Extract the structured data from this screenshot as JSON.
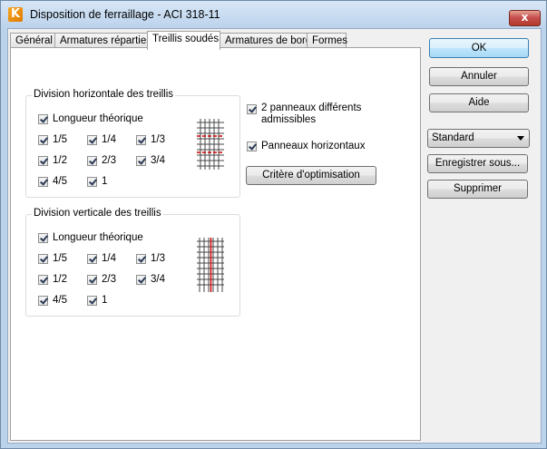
{
  "window": {
    "title": "Disposition de ferraillage - ACI 318-11",
    "app_icon_letter": "K",
    "close_glyph": "x"
  },
  "tabs": [
    {
      "label": "Général",
      "active": false
    },
    {
      "label": "Armatures réparties",
      "active": false
    },
    {
      "label": "Treillis soudés",
      "active": true
    },
    {
      "label": "Armatures de bord",
      "active": false
    },
    {
      "label": "Formes",
      "active": false
    }
  ],
  "horizontal_group": {
    "label": "Division horizontale des treillis",
    "theoretical": {
      "label": "Longueur théorique",
      "checked": true
    },
    "options": [
      {
        "label": "1/5",
        "checked": true
      },
      {
        "label": "1/4",
        "checked": true
      },
      {
        "label": "1/3",
        "checked": true
      },
      {
        "label": "1/2",
        "checked": true
      },
      {
        "label": "2/3",
        "checked": true
      },
      {
        "label": "3/4",
        "checked": true
      },
      {
        "label": "4/5",
        "checked": true
      },
      {
        "label": "1",
        "checked": true
      }
    ]
  },
  "vertical_group": {
    "label": "Division verticale des treillis",
    "theoretical": {
      "label": "Longueur théorique",
      "checked": true
    },
    "options": [
      {
        "label": "1/5",
        "checked": true
      },
      {
        "label": "1/4",
        "checked": true
      },
      {
        "label": "1/3",
        "checked": true
      },
      {
        "label": "1/2",
        "checked": true
      },
      {
        "label": "2/3",
        "checked": true
      },
      {
        "label": "3/4",
        "checked": true
      },
      {
        "label": "4/5",
        "checked": true
      },
      {
        "label": "1",
        "checked": true
      }
    ]
  },
  "side_options": {
    "two_panels": {
      "line1": "2 panneaux différents",
      "line2": "admissibles",
      "checked": true
    },
    "horizontal_panels": {
      "label": "Panneaux horizontaux",
      "checked": true
    },
    "optimization_button": "Critère d'optimisation"
  },
  "buttons": {
    "ok": "OK",
    "cancel": "Annuler",
    "help": "Aide",
    "save_as": "Enregistrer sous...",
    "delete": "Supprimer"
  },
  "preset_select": {
    "value": "Standard"
  },
  "colors": {
    "accent_line": "#d00000",
    "grid_line": "#333333"
  }
}
